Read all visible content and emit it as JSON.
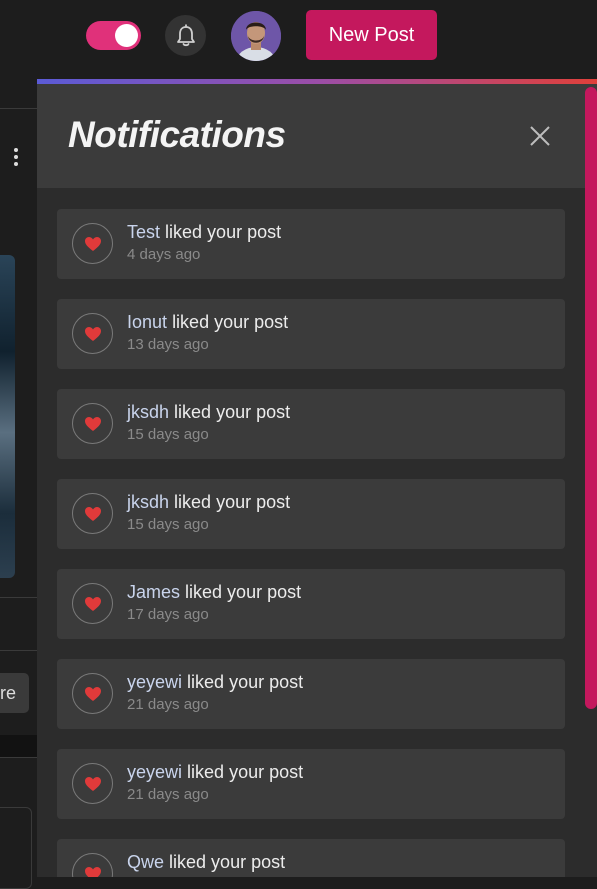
{
  "header": {
    "theme_toggle": "on",
    "new_post_label": "New Post"
  },
  "background_page": {
    "more_button_label": "re"
  },
  "notifications": {
    "title": "Notifications",
    "action_text": "liked your post",
    "items": [
      {
        "user": "Test",
        "time": "4 days ago"
      },
      {
        "user": "Ionut",
        "time": "13 days ago"
      },
      {
        "user": "jksdh",
        "time": "15 days ago"
      },
      {
        "user": "jksdh",
        "time": "15 days ago"
      },
      {
        "user": "James",
        "time": "17 days ago"
      },
      {
        "user": "yeyewi",
        "time": "21 days ago"
      },
      {
        "user": "yeyewi",
        "time": "21 days ago"
      },
      {
        "user": "Qwe",
        "time": ""
      }
    ]
  },
  "colors": {
    "accent": "#c4185d",
    "toggle": "#e0317a",
    "heart": "#e03a3a",
    "panel": "#2c2c2c",
    "card": "#3b3b3b"
  },
  "icons": [
    "bell-icon",
    "close-icon",
    "heart-icon",
    "kebab-menu-icon"
  ]
}
